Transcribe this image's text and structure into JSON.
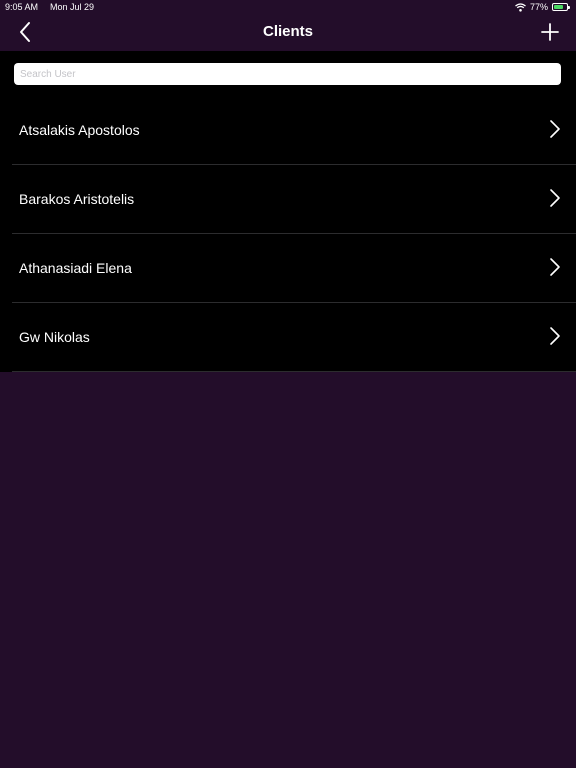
{
  "status_bar": {
    "time": "9:05 AM",
    "date": "Mon Jul 29",
    "battery_percent": "77%",
    "battery_level": 0.77
  },
  "nav": {
    "title": "Clients",
    "back_icon": "chevron-left-icon",
    "add_icon": "plus-icon"
  },
  "search": {
    "placeholder": "Search User",
    "value": ""
  },
  "clients": [
    {
      "name": "Atsalakis Apostolos"
    },
    {
      "name": "Barakos Aristotelis"
    },
    {
      "name": "Athanasiadi Elena"
    },
    {
      "name": "Gw Nikolas"
    }
  ],
  "colors": {
    "background": "#230d2a",
    "list_background": "#000000",
    "battery_fill": "#4cd964"
  }
}
